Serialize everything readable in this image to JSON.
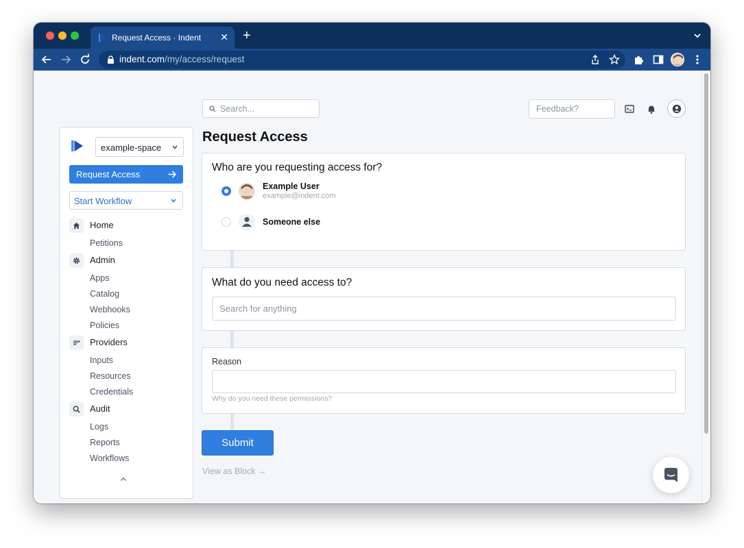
{
  "browser": {
    "tab_title": "Request Access · Indent",
    "url_domain": "indent.com",
    "url_path": "/my/access/request"
  },
  "header": {
    "search_placeholder": "Search...",
    "feedback_placeholder": "Feedback?"
  },
  "sidebar": {
    "space_name": "example-space",
    "request_button": "Request Access",
    "workflow_button": "Start Workflow",
    "sections": [
      {
        "label": "Home",
        "icon": "home-icon",
        "items": [
          "Petitions"
        ]
      },
      {
        "label": "Admin",
        "icon": "gear-icon",
        "items": [
          "Apps",
          "Catalog",
          "Webhooks",
          "Policies"
        ]
      },
      {
        "label": "Providers",
        "icon": "providers-icon",
        "items": [
          "Inputs",
          "Resources",
          "Credentials"
        ]
      },
      {
        "label": "Audit",
        "icon": "search-icon",
        "items": [
          "Logs",
          "Reports",
          "Workflows"
        ]
      }
    ]
  },
  "main": {
    "title": "Request Access",
    "who_card": {
      "heading": "Who are you requesting access for?",
      "options": [
        {
          "name": "Example User",
          "email": "example@indent.com",
          "selected": true
        },
        {
          "name": "Someone else",
          "selected": false
        }
      ]
    },
    "what_card": {
      "heading": "What do you need access to?",
      "placeholder": "Search for anything"
    },
    "reason_card": {
      "label": "Reason",
      "value": "",
      "help": "Why do you need these permissions?"
    },
    "submit_label": "Submit",
    "view_block_label": "View as Block →"
  },
  "colors": {
    "accent": "#2f7ee0",
    "browser_frame": "#1c4b8c"
  }
}
